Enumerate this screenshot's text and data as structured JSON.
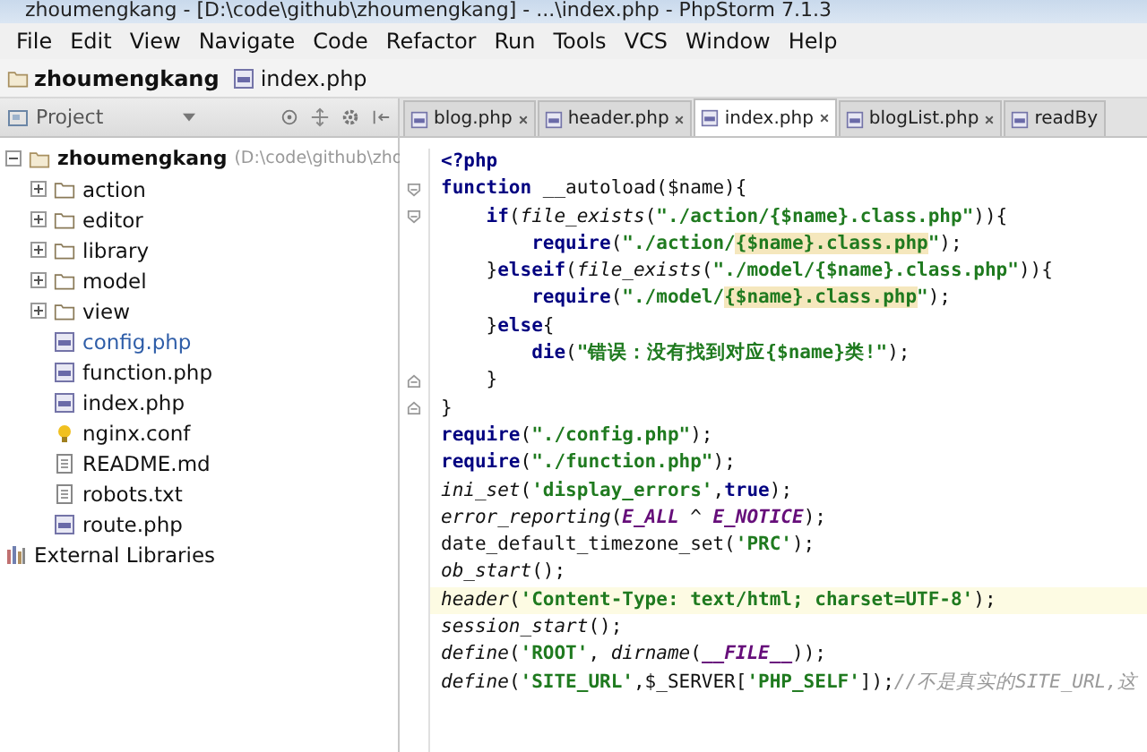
{
  "window": {
    "title": "zhoumengkang - [D:\\code\\github\\zhoumengkang] - ...\\index.php - PhpStorm 7.1.3"
  },
  "menu": [
    "File",
    "Edit",
    "View",
    "Navigate",
    "Code",
    "Refactor",
    "Run",
    "Tools",
    "VCS",
    "Window",
    "Help"
  ],
  "breadcrumb": [
    {
      "label": "zhoumengkang",
      "kind": "folder"
    },
    {
      "label": "index.php",
      "kind": "php"
    }
  ],
  "project_panel": {
    "title": "Project",
    "tree": [
      {
        "name": "zhoumengkang",
        "path": "(D:\\code\\github\\zho",
        "kind": "folder",
        "expanded": true,
        "children": [
          {
            "name": "action",
            "kind": "folder",
            "expanded": false,
            "changed": false
          },
          {
            "name": "editor",
            "kind": "folder",
            "expanded": false,
            "changed": false
          },
          {
            "name": "library",
            "kind": "folder",
            "expanded": false,
            "changed": false
          },
          {
            "name": "model",
            "kind": "folder",
            "expanded": false,
            "changed": false
          },
          {
            "name": "view",
            "kind": "folder",
            "expanded": false,
            "changed": false
          },
          {
            "name": "config.php",
            "kind": "php",
            "changed": true
          },
          {
            "name": "function.php",
            "kind": "php",
            "changed": false
          },
          {
            "name": "index.php",
            "kind": "php",
            "changed": false
          },
          {
            "name": "nginx.conf",
            "kind": "conf",
            "changed": false
          },
          {
            "name": "README.md",
            "kind": "text",
            "changed": false
          },
          {
            "name": "robots.txt",
            "kind": "text",
            "changed": false
          },
          {
            "name": "route.php",
            "kind": "php",
            "changed": false
          }
        ]
      },
      {
        "name": "External Libraries",
        "kind": "library"
      }
    ]
  },
  "tabs": [
    {
      "label": "blog.php",
      "selected": false
    },
    {
      "label": "header.php",
      "selected": false
    },
    {
      "label": "index.php",
      "selected": true
    },
    {
      "label": "blogList.php",
      "selected": false
    },
    {
      "label": "readBy",
      "selected": false
    }
  ],
  "code": [
    {
      "current": false,
      "tokens": [
        {
          "text": "<?php",
          "kind": "keyword"
        }
      ]
    },
    {
      "fold_start": true,
      "current": false,
      "tokens": [
        {
          "text": "function ",
          "kind": "keyword"
        },
        {
          "text": "__autoload($name){",
          "kind": "plain"
        }
      ],
      "children": [
        {
          "fold_start": true,
          "current": false,
          "tokens": [
            {
              "text": "if",
              "kind": "keyword"
            },
            {
              "text": "(",
              "kind": "plain"
            },
            {
              "text": "file_exists",
              "kind": "call"
            },
            {
              "text": "(",
              "kind": "plain"
            },
            {
              "text": "\"./action/{$name}.class.php\"",
              "kind": "string"
            },
            {
              "text": ")){",
              "kind": "plain"
            }
          ],
          "children": [
            {
              "current": false,
              "tokens": [
                {
                  "text": "require",
                  "kind": "keyword"
                },
                {
                  "text": "(",
                  "kind": "plain"
                },
                {
                  "text": "\"./action/",
                  "kind": "string"
                },
                {
                  "text": "{$name}.class.php",
                  "kind": "match"
                },
                {
                  "text": "\"",
                  "kind": "string"
                },
                {
                  "text": ");",
                  "kind": "plain"
                }
              ]
            }
          ]
        },
        {
          "current": false,
          "tokens": [
            {
              "text": "}",
              "kind": "plain"
            },
            {
              "text": "elseif",
              "kind": "keyword"
            },
            {
              "text": "(",
              "kind": "plain"
            },
            {
              "text": "file_exists",
              "kind": "call"
            },
            {
              "text": "(",
              "kind": "plain"
            },
            {
              "text": "\"./model/{$name}.class.php\"",
              "kind": "string"
            },
            {
              "text": ")){",
              "kind": "plain"
            }
          ],
          "children": [
            {
              "current": false,
              "tokens": [
                {
                  "text": "require",
                  "kind": "keyword"
                },
                {
                  "text": "(",
                  "kind": "plain"
                },
                {
                  "text": "\"./model/",
                  "kind": "string"
                },
                {
                  "text": "{$name}.class.php",
                  "kind": "match"
                },
                {
                  "text": "\"",
                  "kind": "string"
                },
                {
                  "text": ");",
                  "kind": "plain"
                }
              ]
            }
          ]
        },
        {
          "current": false,
          "tokens": [
            {
              "text": "}",
              "kind": "plain"
            },
            {
              "text": "else",
              "kind": "keyword"
            },
            {
              "text": "{",
              "kind": "plain"
            }
          ],
          "children": [
            {
              "current": false,
              "tokens": [
                {
                  "text": "die",
                  "kind": "keyword"
                },
                {
                  "text": "(",
                  "kind": "plain"
                },
                {
                  "text": "\"错误：没有找到对应{$name}类!\"",
                  "kind": "string"
                },
                {
                  "text": ");",
                  "kind": "plain"
                }
              ]
            }
          ]
        },
        {
          "fold_end": true,
          "current": false,
          "tokens": [
            {
              "text": "}",
              "kind": "plain"
            }
          ]
        }
      ]
    },
    {
      "fold_end": true,
      "current": false,
      "tokens": [
        {
          "text": "}",
          "kind": "plain"
        }
      ]
    },
    {
      "current": false,
      "tokens": [
        {
          "text": "require",
          "kind": "keyword"
        },
        {
          "text": "(",
          "kind": "plain"
        },
        {
          "text": "\"./config.php\"",
          "kind": "string"
        },
        {
          "text": ");",
          "kind": "plain"
        }
      ]
    },
    {
      "current": false,
      "tokens": [
        {
          "text": "require",
          "kind": "keyword"
        },
        {
          "text": "(",
          "kind": "plain"
        },
        {
          "text": "\"./function.php\"",
          "kind": "string"
        },
        {
          "text": ");",
          "kind": "plain"
        }
      ]
    },
    {
      "current": false,
      "tokens": [
        {
          "text": "ini_set",
          "kind": "call"
        },
        {
          "text": "(",
          "kind": "plain"
        },
        {
          "text": "'display_errors'",
          "kind": "string"
        },
        {
          "text": ",",
          "kind": "plain"
        },
        {
          "text": "true",
          "kind": "keyword"
        },
        {
          "text": ");",
          "kind": "plain"
        }
      ]
    },
    {
      "current": false,
      "tokens": [
        {
          "text": "error_reporting",
          "kind": "call"
        },
        {
          "text": "(",
          "kind": "plain"
        },
        {
          "text": "E_ALL",
          "kind": "constant"
        },
        {
          "text": " ^ ",
          "kind": "plain"
        },
        {
          "text": "E_NOTICE",
          "kind": "constant"
        },
        {
          "text": ");",
          "kind": "plain"
        }
      ]
    },
    {
      "current": false,
      "tokens": [
        {
          "text": "date_default_timezone_set(",
          "kind": "plain"
        },
        {
          "text": "'PRC'",
          "kind": "string"
        },
        {
          "text": ");",
          "kind": "plain"
        }
      ]
    },
    {
      "current": false,
      "tokens": [
        {
          "text": "ob_start",
          "kind": "call"
        },
        {
          "text": "();",
          "kind": "plain"
        }
      ]
    },
    {
      "current": true,
      "tokens": [
        {
          "text": "header",
          "kind": "call"
        },
        {
          "text": "(",
          "kind": "plain"
        },
        {
          "text": "'Content-Type: text/html; charset=UTF-8'",
          "kind": "string"
        },
        {
          "text": ");",
          "kind": "plain"
        }
      ]
    },
    {
      "current": false,
      "tokens": [
        {
          "text": "session_start",
          "kind": "call"
        },
        {
          "text": "();",
          "kind": "plain"
        }
      ]
    },
    {
      "current": false,
      "tokens": [
        {
          "text": "define",
          "kind": "call"
        },
        {
          "text": "(",
          "kind": "plain"
        },
        {
          "text": "'ROOT'",
          "kind": "string"
        },
        {
          "text": ", ",
          "kind": "plain"
        },
        {
          "text": "dirname",
          "kind": "call"
        },
        {
          "text": "(",
          "kind": "plain"
        },
        {
          "text": "__FILE__",
          "kind": "constant"
        },
        {
          "text": "));",
          "kind": "plain"
        }
      ]
    },
    {
      "current": false,
      "tokens": [
        {
          "text": "define",
          "kind": "call"
        },
        {
          "text": "(",
          "kind": "plain"
        },
        {
          "text": "'SITE_URL'",
          "kind": "string"
        },
        {
          "text": ",$_SERVER[",
          "kind": "plain"
        },
        {
          "text": "'PHP_SELF'",
          "kind": "string"
        },
        {
          "text": "]);",
          "kind": "plain"
        },
        {
          "text": "//不是真实的SITE_URL,这",
          "kind": "comment"
        }
      ]
    }
  ]
}
